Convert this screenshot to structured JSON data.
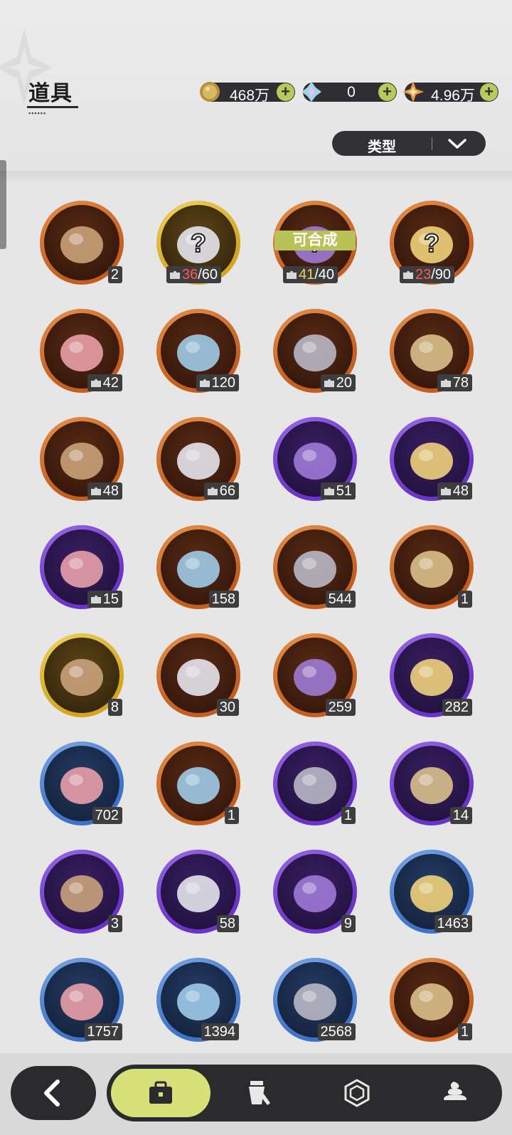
{
  "header": {
    "title": "道具",
    "currencies": [
      {
        "icon": "gold-coin-icon",
        "value": "468万"
      },
      {
        "icon": "crystal-icon",
        "value": "0"
      },
      {
        "icon": "star-shard-icon",
        "value": "4.96万"
      }
    ],
    "filter_label": "类型"
  },
  "craft_label": "可合成",
  "items": [
    {
      "icon": "purple-rune-crystal-icon",
      "ring": "orange",
      "count": "2"
    },
    {
      "icon": "mystery-bear-fragment-icon",
      "ring": "gold",
      "have": "36",
      "need": "/60",
      "have_color": "red"
    },
    {
      "icon": "mystery-bear-fragment-icon",
      "ring": "orange",
      "have": "41",
      "need": "/40",
      "have_color": "yellow",
      "craftable": true
    },
    {
      "icon": "mystery-bear-fragment-icon",
      "ring": "orange",
      "have": "23",
      "need": "/90",
      "have_color": "red"
    },
    {
      "icon": "brown-bear-fragment-icon",
      "ring": "orange",
      "count": "42",
      "puzzle": true
    },
    {
      "icon": "knight-helmet-bear-fragment-icon",
      "ring": "orange",
      "count": "120",
      "puzzle": true
    },
    {
      "icon": "white-cat-fragment-icon",
      "ring": "orange",
      "count": "20",
      "puzzle": true
    },
    {
      "icon": "white-tiger-fragment-icon",
      "ring": "orange",
      "count": "78",
      "puzzle": true
    },
    {
      "icon": "red-eye-bear-fragment-icon",
      "ring": "orange",
      "count": "48",
      "puzzle": true
    },
    {
      "icon": "purple-mech-cat-fragment-icon",
      "ring": "orange",
      "count": "66",
      "puzzle": true
    },
    {
      "icon": "leaf-cat-fragment-icon",
      "ring": "purple",
      "count": "51",
      "puzzle": true
    },
    {
      "icon": "brown-boar-fragment-icon",
      "ring": "purple",
      "count": "48",
      "puzzle": true
    },
    {
      "icon": "yellow-dog-fragment-icon",
      "ring": "purple",
      "count": "15",
      "puzzle": true
    },
    {
      "icon": "purple-star-gem-icon",
      "ring": "orange",
      "count": "158"
    },
    {
      "icon": "blue-star-gem-icon",
      "ring": "orange",
      "count": "544"
    },
    {
      "icon": "paw-charm-icon",
      "ring": "orange",
      "count": "1"
    },
    {
      "icon": "gold-character-card-icon",
      "ring": "gold",
      "count": "8"
    },
    {
      "icon": "rainbow-character-card-icon",
      "ring": "orange",
      "count": "30"
    },
    {
      "icon": "orange-character-card-icon",
      "ring": "orange",
      "count": "259"
    },
    {
      "icon": "purple-character-card-icon",
      "ring": "purple",
      "count": "282"
    },
    {
      "icon": "blue-character-card-icon",
      "ring": "blue",
      "count": "702"
    },
    {
      "icon": "refresh-card-icon",
      "ring": "orange",
      "count": "1"
    },
    {
      "icon": "gift-box-icon",
      "ring": "purple",
      "count": "1"
    },
    {
      "icon": "golden-bell-icon",
      "ring": "purple",
      "count": "14"
    },
    {
      "icon": "magic-mirror-icon",
      "ring": "purple",
      "count": "3"
    },
    {
      "icon": "scroll-icon",
      "ring": "purple",
      "count": "58"
    },
    {
      "icon": "peach-fruit-icon",
      "ring": "purple",
      "count": "9"
    },
    {
      "icon": "shovel-icon",
      "ring": "blue",
      "count": "1463"
    },
    {
      "icon": "boxing-glove-icon",
      "ring": "blue",
      "count": "1757"
    },
    {
      "icon": "pickaxe-icon",
      "ring": "blue",
      "count": "1394"
    },
    {
      "icon": "hammer-icon",
      "ring": "blue",
      "count": "2568"
    },
    {
      "icon": "golden-key-icon",
      "ring": "orange",
      "count": "1"
    }
  ],
  "bottom_nav": {
    "back": "back-arrow-icon",
    "tabs": [
      {
        "icon": "briefcase-icon",
        "active": true
      },
      {
        "icon": "costume-icon",
        "active": false
      },
      {
        "icon": "hexagon-gem-icon",
        "active": false
      },
      {
        "icon": "cake-icon",
        "active": false
      }
    ]
  },
  "colors": {
    "orange": "#d9792d",
    "gold": "#e6c02e",
    "purple": "#7b44d6",
    "blue": "#4f86d6",
    "accent": "#d8e07a"
  }
}
